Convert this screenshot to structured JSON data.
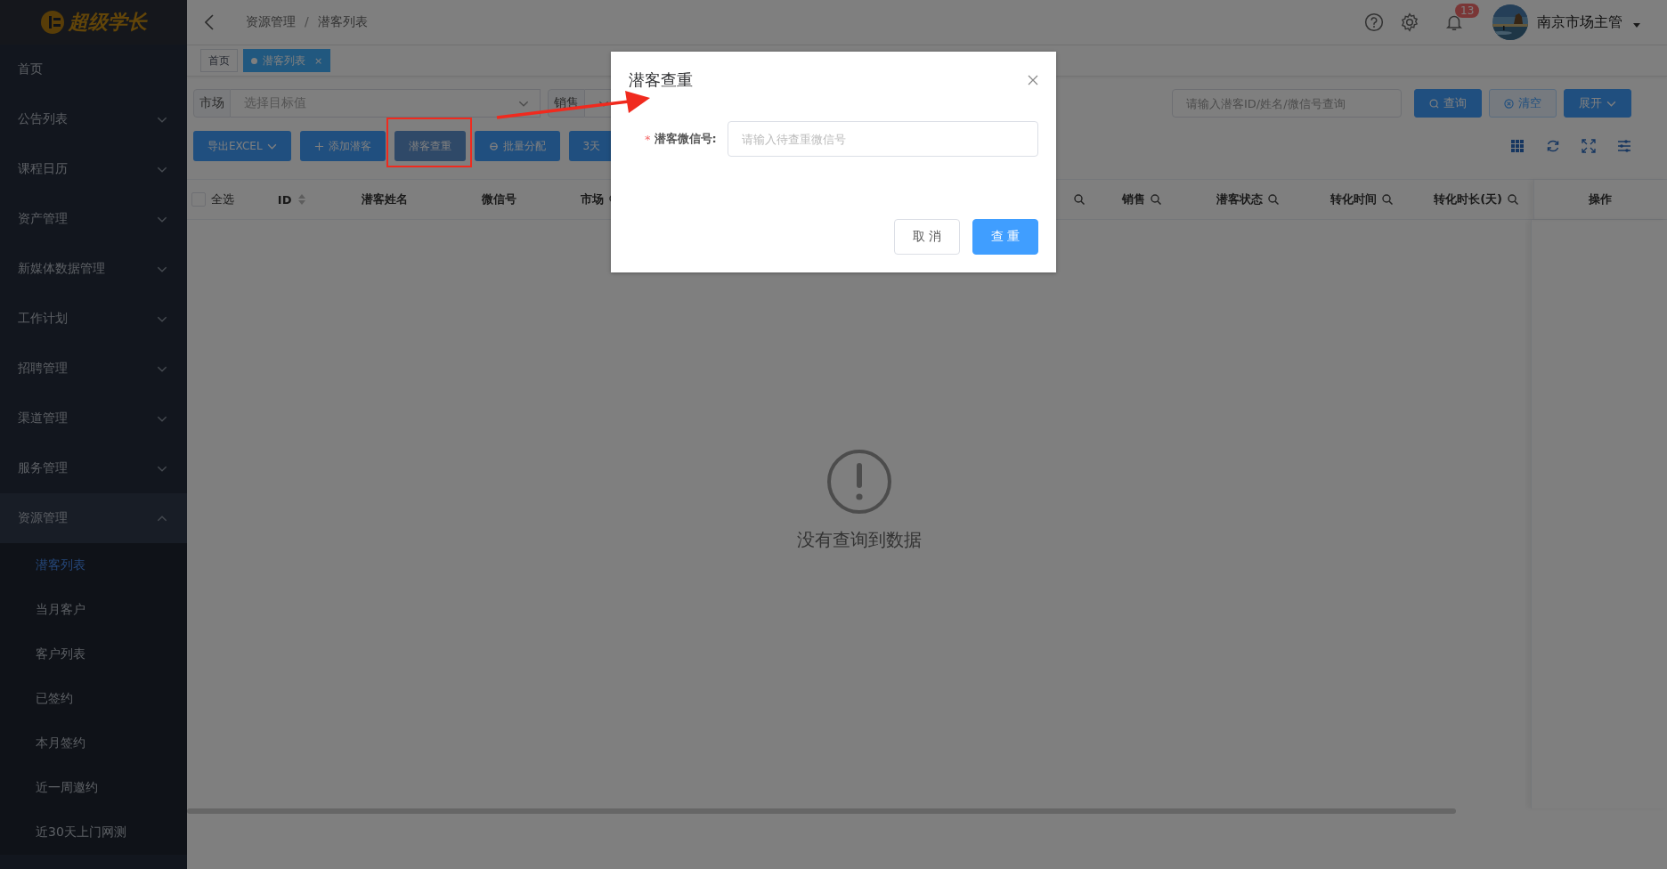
{
  "logo": {
    "text": "超级学长"
  },
  "sidebar": {
    "items": [
      {
        "label": "首页",
        "kind": "link"
      },
      {
        "label": "公告列表",
        "kind": "group",
        "expanded": false
      },
      {
        "label": "课程日历",
        "kind": "group",
        "expanded": false
      },
      {
        "label": "资产管理",
        "kind": "group",
        "expanded": false
      },
      {
        "label": "新媒体数据管理",
        "kind": "group",
        "expanded": false
      },
      {
        "label": "工作计划",
        "kind": "group",
        "expanded": false
      },
      {
        "label": "招聘管理",
        "kind": "group",
        "expanded": false
      },
      {
        "label": "渠道管理",
        "kind": "group",
        "expanded": false
      },
      {
        "label": "服务管理",
        "kind": "group",
        "expanded": false
      },
      {
        "label": "资源管理",
        "kind": "group",
        "expanded": true,
        "children": [
          {
            "label": "潜客列表",
            "selected": true
          },
          {
            "label": "当月客户",
            "selected": false
          },
          {
            "label": "客户列表",
            "selected": false
          },
          {
            "label": "已签约",
            "selected": false
          },
          {
            "label": "本月签约",
            "selected": false
          },
          {
            "label": "近一周邀约",
            "selected": false
          },
          {
            "label": "近30天上门网测",
            "selected": false
          }
        ]
      }
    ]
  },
  "header": {
    "breadcrumb": [
      "资源管理",
      "潜客列表"
    ],
    "separator": "/",
    "notification_count": "13",
    "user": "南京市场主管"
  },
  "tabs": [
    {
      "label": "首页",
      "selected": false
    },
    {
      "label": "潜客列表",
      "selected": true,
      "close": "×"
    }
  ],
  "filters": [
    {
      "label": "市场",
      "placeholder": "选择目标值"
    },
    {
      "label": "销售"
    }
  ],
  "search": {
    "placeholder": "请输入潜客ID/姓名/微信号查询",
    "buttons": [
      {
        "label": "查询",
        "kind": "search"
      },
      {
        "label": "清空",
        "kind": "clear"
      },
      {
        "label": "展开",
        "kind": "expand"
      }
    ]
  },
  "toolbar": [
    {
      "label": "导出EXCEL",
      "kind": "dropdown",
      "highlighted": false
    },
    {
      "label": "添加潜客",
      "kind": "add",
      "highlighted": false
    },
    {
      "label": "潜客查重",
      "kind": "plain",
      "highlighted": true
    },
    {
      "label": "批量分配",
      "kind": "assign",
      "highlighted": false
    },
    {
      "label": "3天",
      "kind": "plain",
      "highlighted": false
    }
  ],
  "table": {
    "select_all": {
      "label": "全选",
      "checked": false
    },
    "columns": [
      {
        "label": "ID",
        "kind": "sort"
      },
      {
        "label": "潜客姓名",
        "kind": "plain"
      },
      {
        "label": "微信号",
        "kind": "plain"
      },
      {
        "label": "市场",
        "kind": "search"
      },
      {
        "kind": "search"
      },
      {
        "label": "销售",
        "kind": "search"
      },
      {
        "label": "潜客状态",
        "kind": "search"
      },
      {
        "label": "转化时间",
        "kind": "search"
      },
      {
        "label": "转化时长(天)",
        "kind": "search"
      },
      {
        "label": "操作",
        "kind": "plain"
      }
    ],
    "empty_text": "没有查询到数据"
  },
  "dialog": {
    "title": "潜客查重",
    "field": {
      "label": "潜客微信号:",
      "required_mark": "*",
      "placeholder": "请输入待查重微信号"
    },
    "buttons": [
      {
        "label": "取 消",
        "kind": "cancel"
      },
      {
        "label": "查 重",
        "kind": "primary"
      }
    ]
  }
}
